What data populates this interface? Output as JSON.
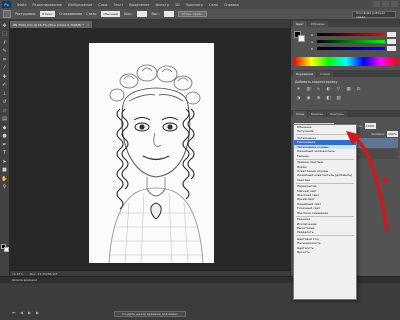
{
  "menubar": {
    "logo": "Ps",
    "items": [
      "Файл",
      "Редактирование",
      "Изображение",
      "Слои",
      "Текст",
      "Выделение",
      "Фильтр",
      "3D",
      "Просмотр",
      "Окно",
      "Справка"
    ]
  },
  "options": {
    "feather_label": "Растушевка:",
    "feather_value": "0 пикс.",
    "antialias_label": "Сглаживание",
    "style_label": "Стиль:",
    "style_value": "Обычный",
    "width_label": "Шир.:",
    "height_label": "Выс.:",
    "refine_button": "Уточн. край...",
    "workspace": "Основная рабочая среда"
  },
  "document": {
    "tab_title": "ZN 7093_lhl1 @ 16,7% (Фон копия 3, RGB/8) *",
    "zoom": "16,67%",
    "doc_size": "Док: 34,3М/86,9М"
  },
  "timeline": {
    "title": "Шкала времени",
    "create_button": "Создать шкалу времени для видео"
  },
  "color_panel": {
    "tabs": [
      "Цвет",
      "Образцы"
    ],
    "labels": [
      "R",
      "G",
      "B"
    ]
  },
  "adjust_panel": {
    "tabs": [
      "Коррекция",
      "Стили"
    ],
    "title": "Добавить корректировку"
  },
  "layers_panel": {
    "tabs": [
      "Слои",
      "Каналы",
      "Контуры"
    ],
    "blend_value": "Обычные",
    "opacity_label": "Непрозрачность:",
    "opacity_value": "100%",
    "fill_label": "Заливка:",
    "fill_value": "100%",
    "layers": [
      "Фон копия 3",
      "Фон"
    ]
  },
  "blend_modes": {
    "groups": [
      [
        "Обычные",
        "Затухание"
      ],
      [
        "Затемнение",
        "Умножение",
        "Затемнение основы",
        "Линейный затемнитель",
        "Темнее"
      ],
      [
        "Замена светлым",
        "Экран",
        "Осветление основы",
        "Линейный осветлитель (добавить)",
        "Светлее"
      ],
      [
        "Перекрытие",
        "Мягкий свет",
        "Жесткий свет",
        "Яркий свет",
        "Линейный свет",
        "Точечный свет",
        "Жесткое смешение"
      ],
      [
        "Разница",
        "Исключение",
        "Вычитание",
        "Разделить"
      ],
      [
        "Цветовой тон",
        "Насыщенность",
        "Цветность",
        "Яркость"
      ]
    ],
    "selected": "Умножение",
    "hovered": "Затемнение основы"
  },
  "tools": [
    "move-tool",
    "marquee-tool",
    "lasso-tool",
    "quick-select-tool",
    "crop-tool",
    "eyedropper-tool",
    "healing-tool",
    "brush-tool",
    "stamp-tool",
    "history-brush-tool",
    "eraser-tool",
    "gradient-tool",
    "blur-tool",
    "dodge-tool",
    "pen-tool",
    "type-tool",
    "path-select-tool",
    "shape-tool",
    "hand-tool",
    "zoom-tool"
  ],
  "annotation_color": "#d01a1a"
}
